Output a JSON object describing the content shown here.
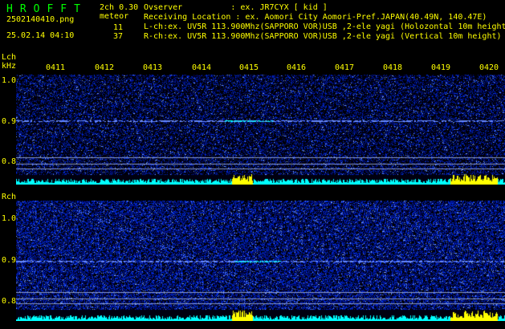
{
  "header": {
    "title": "HROFFT",
    "version": "2ch 0.30",
    "meteor_label": "meteor",
    "filename": "2502140410.png",
    "datetime": "25.02.14 04:10",
    "count_l": "11",
    "count_r": "37",
    "observer": "Ovserver          : ex. JR7CYX [ kid ]",
    "location": "Receiving Location : ex. Aomori City Aomori-Pref.JAPAN(40.49N, 140.47E)",
    "lch_info": "L-ch:ex. UV5R 113.900Mhz(SAPPORO VOR)USB ,2-ele yagi (Holozontal 10m height)",
    "rch_info": "R-ch:ex. UV5R 113.900Mhz(SAPPORO VOR)USB ,2-ele yagi (Vertical 10m height)"
  },
  "lch": {
    "label": "Lch",
    "unit": "kHz",
    "ticks": [
      "1.0",
      "0.9",
      "0.8"
    ]
  },
  "rch": {
    "label": "Rch",
    "ticks": [
      "1.0",
      "0.9",
      "0.8"
    ]
  },
  "time_labels": [
    "0411",
    "0412",
    "0413",
    "0414",
    "0415",
    "0416",
    "0417",
    "0418",
    "0419",
    "0420"
  ],
  "colors": {
    "label": "#ffff00",
    "title": "#00ff00",
    "spectrum_bg": "#00008b",
    "signal": "#00ffff",
    "burst": "#ffff00"
  }
}
